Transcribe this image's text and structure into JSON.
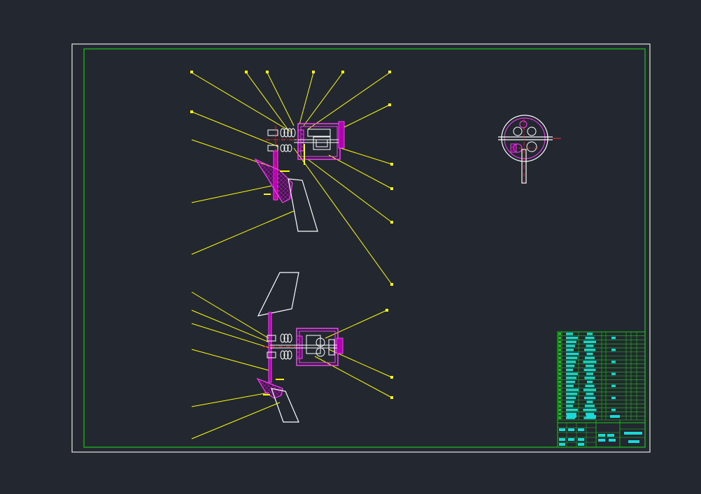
{
  "viewport": {
    "background": "#232830"
  },
  "colors": {
    "sheet_border": "#e6e6e6",
    "frame": "#19c519",
    "leader": "#ffff00",
    "outline": "#ffffff",
    "part": "#ff3bff",
    "hatch": "#b000b0",
    "center_line": "#ff2a2a",
    "table_line": "#19c519",
    "table_text": "#19d9d9"
  },
  "drawing": {
    "views": [
      {
        "name": "upper-assembly-view"
      },
      {
        "name": "lower-assembly-view"
      },
      {
        "name": "side-detail-view"
      }
    ],
    "title_block": {
      "rows": 22,
      "columns": 7
    }
  }
}
